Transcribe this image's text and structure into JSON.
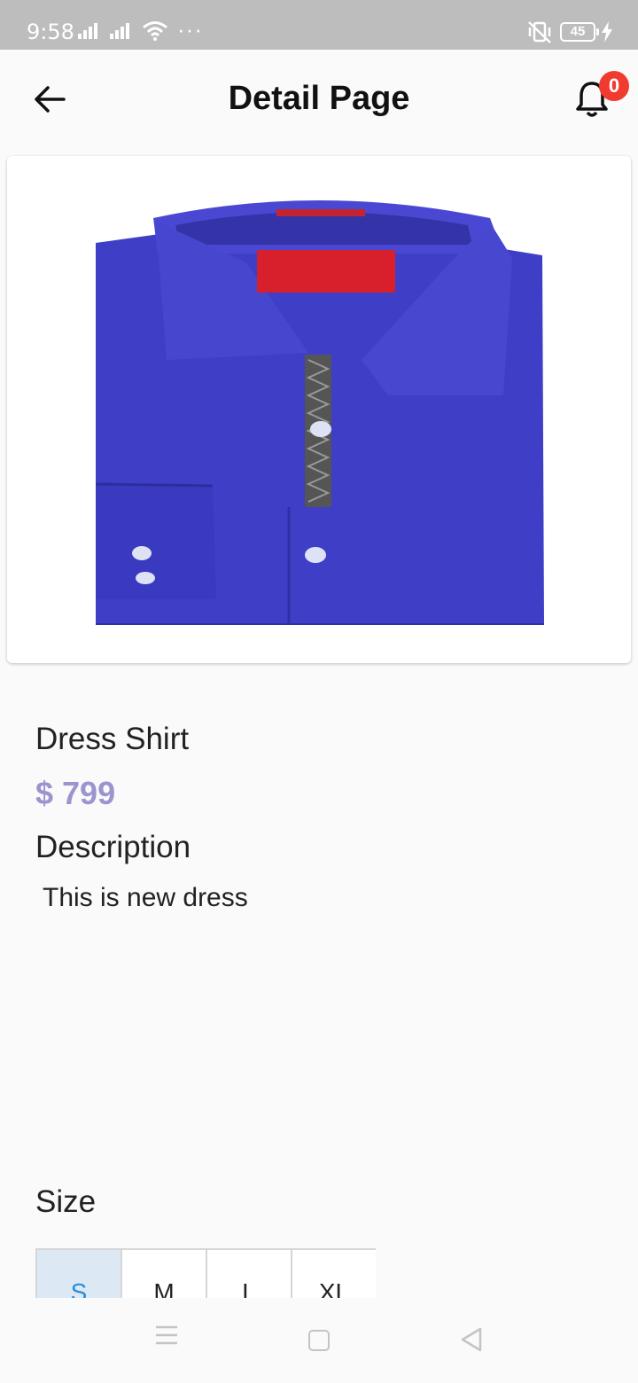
{
  "status_bar": {
    "time": "9:58",
    "battery": "45",
    "icons": [
      "signal-icon",
      "signal-icon",
      "wifi-icon",
      "more-dots-icon",
      "vibrate-mute-icon",
      "battery-icon",
      "charging-bolt-icon"
    ]
  },
  "app_bar": {
    "title": "Detail Page",
    "back_icon": "arrow-left-icon",
    "notification_icon": "bell-icon",
    "notification_count": "0"
  },
  "product": {
    "image": "blue-dress-shirt-image",
    "name": "Dress Shirt",
    "price": "$ 799",
    "description_heading": "Description",
    "description": "This is new dress",
    "size_heading": "Size",
    "sizes": [
      "S",
      "M",
      "L",
      "XL"
    ],
    "selected_size": "S"
  },
  "colors": {
    "price": "#9b94cf",
    "badge": "#f23b2f",
    "selected_size_bg": "#dce9f5",
    "selected_size_text": "#2b8bd6",
    "shirt": "#3f3fc8"
  },
  "nav_bar": {
    "icons": [
      "menu-icon",
      "home-square-icon",
      "back-triangle-icon"
    ]
  }
}
